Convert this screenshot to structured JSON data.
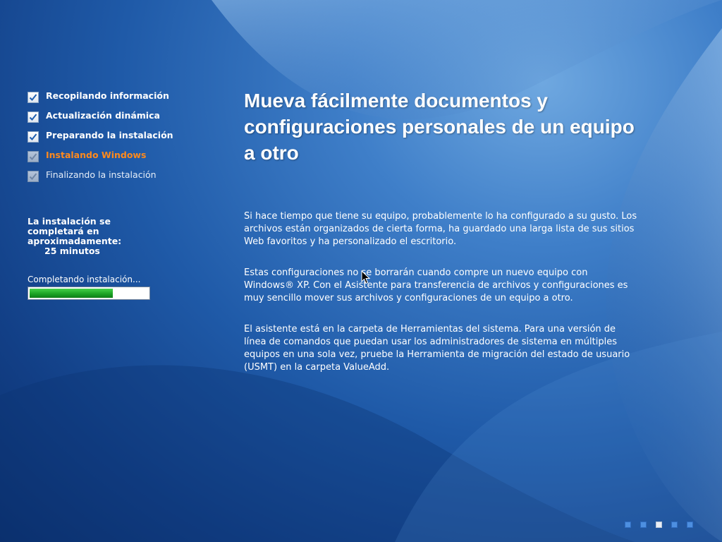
{
  "steps": [
    {
      "label": "Recopilando información",
      "state": "done"
    },
    {
      "label": "Actualización dinámica",
      "state": "done"
    },
    {
      "label": "Preparando la instalación",
      "state": "done"
    },
    {
      "label": "Instalando Windows",
      "state": "current"
    },
    {
      "label": "Finalizando la instalación",
      "state": "pending"
    }
  ],
  "eta": {
    "line1": "La instalación se",
    "line2": "completará en",
    "line3": "aproximadamente:",
    "minutes": "25 minutos"
  },
  "progress": {
    "label": "Completando instalación...",
    "percent": 70
  },
  "content": {
    "headline": "Mueva fácilmente documentos y configuraciones personales de un equipo a otro",
    "paragraphs": [
      "Si hace tiempo que tiene su equipo, probablemente lo ha configurado a su gusto. Los archivos están organizados de cierta forma, ha guardado una larga lista de sus sitios Web favoritos y ha personalizado el escritorio.",
      "Estas configuraciones no se borrarán cuando compre un nuevo equipo con Windows® XP. Con el Asistente para transferencia de archivos y configuraciones es muy sencillo mover sus archivos y configuraciones de un equipo a otro.",
      "El asistente está en la carpeta de Herramientas del sistema. Para una versión de línea de comandos que puedan usar los administradores de sistema en múltiples equipos en una sola vez, pruebe la Herramienta de migración del estado de usuario (USMT) en la carpeta ValueAdd."
    ]
  },
  "slides": {
    "count": 5,
    "active_index": 2
  },
  "colors": {
    "current_step": "#ff8a1c",
    "progress_fill": "#1aa023",
    "background": "#1f5aa8"
  }
}
